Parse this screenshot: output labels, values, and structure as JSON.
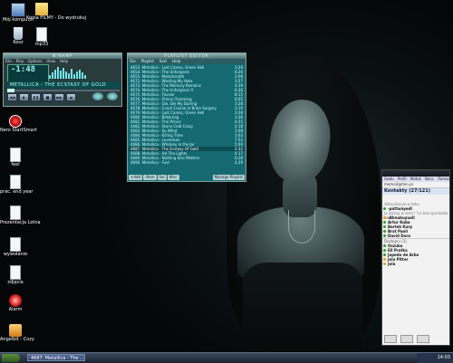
{
  "desktop": {
    "icons": [
      {
        "label": "Mój komputer",
        "icon": "computer-icon"
      },
      {
        "label": "Kopia FILMY - Do wydrukuj",
        "icon": "folder-icon"
      },
      {
        "label": "Kosz",
        "icon": "recycle-bin-icon"
      },
      {
        "label": "mp33",
        "icon": "document-icon"
      },
      {
        "label": "Nero StartSmart",
        "icon": "nero-icon"
      },
      {
        "label": "feel",
        "icon": "document-icon"
      },
      {
        "label": "prac. end year",
        "icon": "document-icon"
      },
      {
        "label": "Prezentacja Lotna",
        "icon": "document-icon"
      },
      {
        "label": "wywołanie",
        "icon": "document-icon"
      },
      {
        "label": "zdjęcia",
        "icon": "document-icon"
      },
      {
        "label": "Alarm",
        "icon": "alarm-icon"
      },
      {
        "label": "Angelbit - Cozy",
        "icon": "angelbit-icon"
      }
    ]
  },
  "winamp": {
    "title": "WINAMP",
    "menu": [
      "File",
      "Play",
      "Options",
      "View",
      "Help"
    ],
    "time": "-1:48",
    "ticker": "METALLICA - THE ECSTASY OF GOLD",
    "controls": [
      "◀◀",
      "▶",
      "❚❚",
      "■",
      "▶▶",
      "⏏"
    ],
    "spectrum": [
      4,
      7,
      10,
      13,
      9,
      12,
      8,
      6,
      11,
      5,
      8,
      10,
      7,
      4
    ]
  },
  "playlist": {
    "title": "PLAYLIST EDITOR",
    "menu": [
      "File",
      "Playlist",
      "Sort",
      "Help"
    ],
    "tracks": [
      {
        "title": "4653. Metallica - Last Caress, Green Hell",
        "time": "3:28"
      },
      {
        "title": "4654. Metallica - The Unforgiven",
        "time": "6:26"
      },
      {
        "title": "4655. Metallica - Motorbreath",
        "time": "3:08"
      },
      {
        "title": "4672. Metallica - Wasting My Hate",
        "time": "3:57"
      },
      {
        "title": "4673. Metallica - The Memory Remains",
        "time": "4:39"
      },
      {
        "title": "4674. Metallica - The Unforgiven II",
        "time": "6:36"
      },
      {
        "title": "4675. Metallica - Fixxxer",
        "time": "8:15"
      },
      {
        "title": "4676. Metallica - Prince Charming",
        "time": "6:05"
      },
      {
        "title": "4677. Metallica - Die, Die My Darling",
        "time": "3:28"
      },
      {
        "title": "4678. Metallica - Crash Course in Brain Surgery",
        "time": "3:10"
      },
      {
        "title": "4679. Metallica - Last Caress, Green Hell",
        "time": "3:28"
      },
      {
        "title": "4680. Metallica - Blitzkrieg",
        "time": "3:36"
      },
      {
        "title": "4681. Metallica - The Prince",
        "time": "4:25"
      },
      {
        "title": "4682. Metallica - Stone Cold Crazy",
        "time": "2:18"
      },
      {
        "title": "4683. Metallica - So What",
        "time": "3:08"
      },
      {
        "title": "4684. Metallica - Killing Time",
        "time": "3:03"
      },
      {
        "title": "4685. Metallica - Loverman",
        "time": "7:52"
      },
      {
        "title": "4686. Metallica - Whiskey in the Jar",
        "time": "5:04"
      },
      {
        "title": "4687. Metallica - The Ecstasy Of Gold",
        "time": "2:32"
      },
      {
        "title": "4688. Metallica - Hit The Lights",
        "time": "4:17"
      },
      {
        "title": "4689. Metallica - Nothing Else Matters",
        "time": "6:28"
      },
      {
        "title": "4690. Metallica - Fuel",
        "time": "4:29"
      }
    ],
    "selected_index": 18,
    "buttons": [
      "+Add",
      "-Rem",
      "Sel",
      "Misc",
      "Manage Playlist"
    ]
  },
  "messenger": {
    "menu": [
      "Gadu",
      "Profil",
      "Widok",
      "Narz.",
      "Pomoc"
    ],
    "me": "meme2@tlen.pl",
    "header": "Kontakty (27/121)",
    "items": [
      {
        "text": "Aktualizacje w toku",
        "kind": "desc"
      },
      {
        "text": "-pattwayedl",
        "kind": "b",
        "status": "#2b9a2b"
      },
      {
        "text": "Ja dzisiaj w sieci! \"co bez sprzedała tak!\"",
        "kind": "desc"
      },
      {
        "text": "-Ahnukuyuoll",
        "kind": "b",
        "status": "#e0a020"
      },
      {
        "text": "Artur Kuba",
        "kind": "b",
        "status": "#2b9a2b"
      },
      {
        "text": "Bartek Kurp",
        "kind": "b",
        "status": "#2b9a2b"
      },
      {
        "text": "Brat Paoli",
        "kind": "b",
        "status": "#2b9a2b"
      },
      {
        "text": "David Dora",
        "kind": "b",
        "status": "#2b9a2b"
      },
      {
        "text": "Dostępni (3)",
        "kind": "sec"
      },
      {
        "text": "Oszuku",
        "kind": "b",
        "status": "#2b9a2b"
      },
      {
        "text": "Ell Pratka",
        "kind": "b",
        "status": "#2b9a2b"
      },
      {
        "text": "Japedo de Arbo",
        "kind": "b",
        "status": "#2b9a2b"
      },
      {
        "text": "Jola Pitter",
        "kind": "b",
        "status": "#e0a020"
      },
      {
        "text": "Jola",
        "kind": "b",
        "status": "#e0a020"
      }
    ]
  },
  "taskbar": {
    "start": "start",
    "task": "4687. Metallica - The ...",
    "clock": "14:03"
  }
}
